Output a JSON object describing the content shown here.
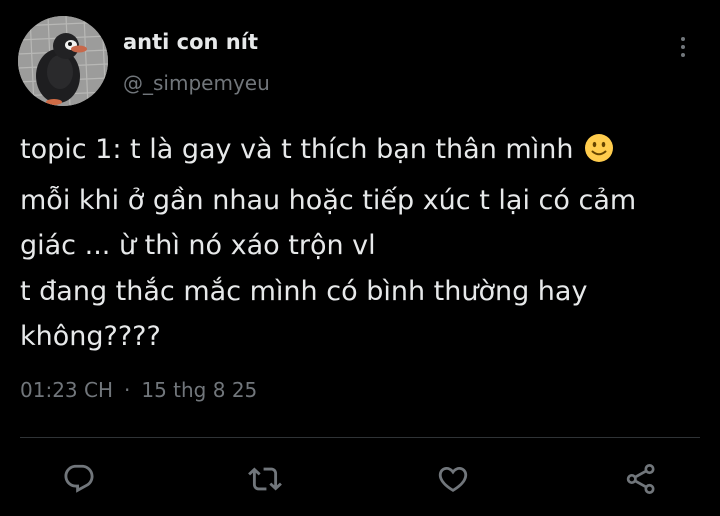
{
  "author": {
    "display_name": "anti con nít",
    "handle": "@_simpemyeu"
  },
  "tweet": {
    "lines": [
      "topic 1: t là gay và t thích bạn thân mình",
      "mỗi khi ở gần nhau hoặc tiếp xúc t lại có cảm",
      "giác ... ừ thì nó xáo trộn vl",
      "t đang thắc mắc mình có bình thường hay",
      "không????"
    ],
    "emoji": "slightly-smiling-face"
  },
  "meta": {
    "time": "01:23 CH",
    "separator": "·",
    "date": "15 thg 8 25"
  },
  "icons": {
    "more": "more-vertical-icon",
    "reply": "reply-icon",
    "retweet": "retweet-icon",
    "like": "heart-icon",
    "share": "share-icon"
  },
  "colors": {
    "background": "#000000",
    "text_primary": "#e7e9ea",
    "text_secondary": "#71767b",
    "divider": "#2f3336",
    "emoji_yellow": "#ffcc4d"
  }
}
